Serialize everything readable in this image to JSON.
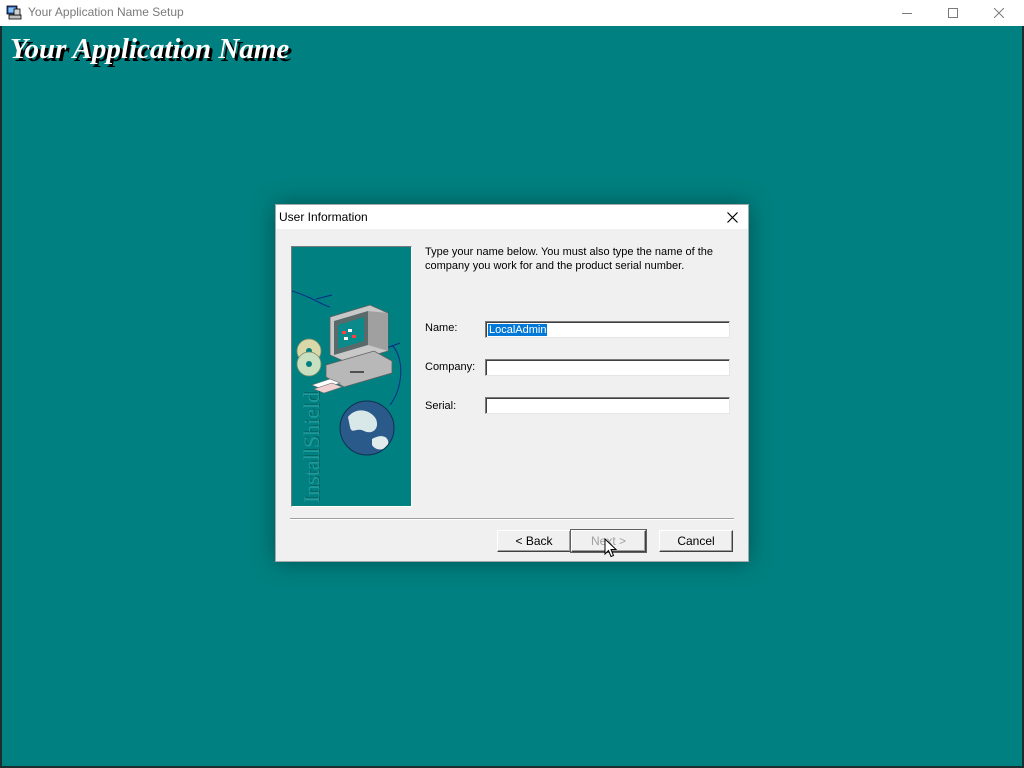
{
  "window": {
    "title": "Your Application Name Setup",
    "banner": "Your Application Name",
    "background_color": "#008080",
    "icons": [
      "setup-app-icon",
      "minimize-icon",
      "maximize-icon",
      "close-icon"
    ]
  },
  "dialog": {
    "title": "User Information",
    "instructions": "Type your name below. You must also type the name of the company you work for and the product serial number.",
    "side_image_text": "InstallShield",
    "fields": [
      {
        "label": "Name:",
        "value": "LocalAdmin",
        "selected": true
      },
      {
        "label": "Company:",
        "value": ""
      },
      {
        "label": "Serial:",
        "value": ""
      }
    ],
    "buttons": {
      "back": "< Back",
      "next": "Next >",
      "cancel": "Cancel"
    },
    "next_enabled": false
  }
}
